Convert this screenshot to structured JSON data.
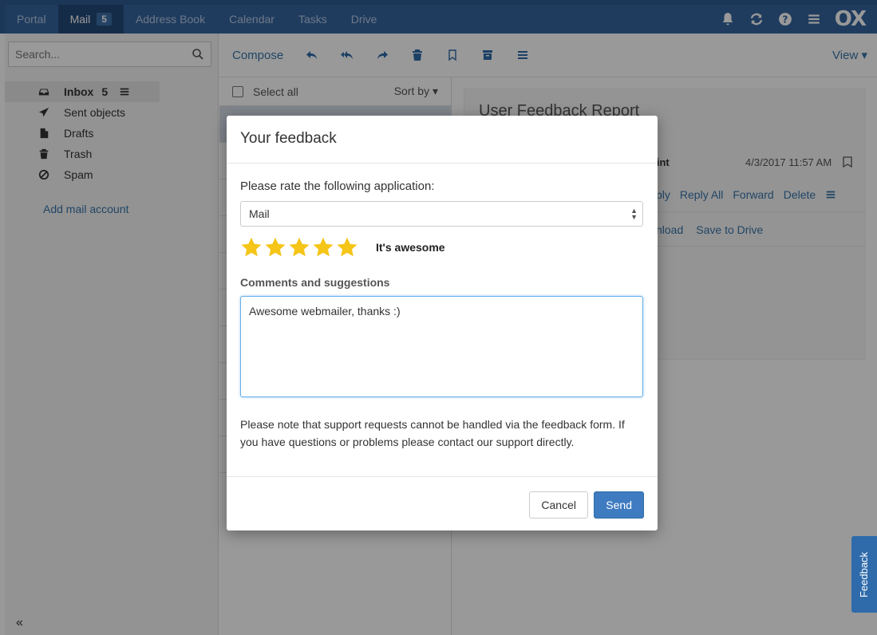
{
  "topbar": {
    "tabs": [
      {
        "label": "Portal"
      },
      {
        "label": "Mail",
        "count": "5"
      },
      {
        "label": "Address Book"
      },
      {
        "label": "Calendar"
      },
      {
        "label": "Tasks"
      },
      {
        "label": "Drive"
      }
    ],
    "logo": "OX",
    "icons": [
      "bell-icon",
      "refresh-icon",
      "help-icon",
      "menu-icon"
    ]
  },
  "sidebar": {
    "search_placeholder": "Search...",
    "folders": [
      {
        "label": "Inbox",
        "count": "5",
        "icon": "inbox-icon"
      },
      {
        "label": "Sent objects",
        "icon": "paper-plane-icon"
      },
      {
        "label": "Drafts",
        "icon": "document-icon"
      },
      {
        "label": "Trash",
        "icon": "trash-icon"
      },
      {
        "label": "Spam",
        "icon": "ban-icon"
      }
    ],
    "add_account": "Add mail account",
    "collapse": "«"
  },
  "toolbar": {
    "compose": "Compose",
    "view": "View ▾",
    "icons": [
      "reply-icon",
      "reply-all-icon",
      "forward-icon",
      "delete-icon",
      "flag-icon",
      "archive-icon",
      "more-icon"
    ]
  },
  "list": {
    "select_all": "Select all",
    "sort_by": "Sort by ▾"
  },
  "detail": {
    "subject": "User Feedback Report",
    "sender_partial": "e.int",
    "date": "4/3/2017 11:57 AM",
    "actions": [
      "ply",
      "Reply All",
      "Forward",
      "Delete"
    ],
    "attachment_actions": [
      "nload",
      "Save to Drive"
    ]
  },
  "feedback_tab": "Feedback",
  "modal": {
    "title": "Your feedback",
    "rate_label": "Please rate the following application:",
    "app_selected": "Mail",
    "rating": {
      "value": 5,
      "max": 5,
      "text": "It's awesome"
    },
    "comments_label": "Comments and suggestions",
    "comments_value": "Awesome webmailer, thanks :)",
    "note": "Please note that support requests cannot be handled via the feedback form. If you have questions or problems please contact our support directly.",
    "cancel_label": "Cancel",
    "send_label": "Send"
  },
  "colors": {
    "topbar": "#34659f",
    "accent": "#3774a8",
    "star": "#f5c518",
    "send": "#3f7bc0"
  }
}
